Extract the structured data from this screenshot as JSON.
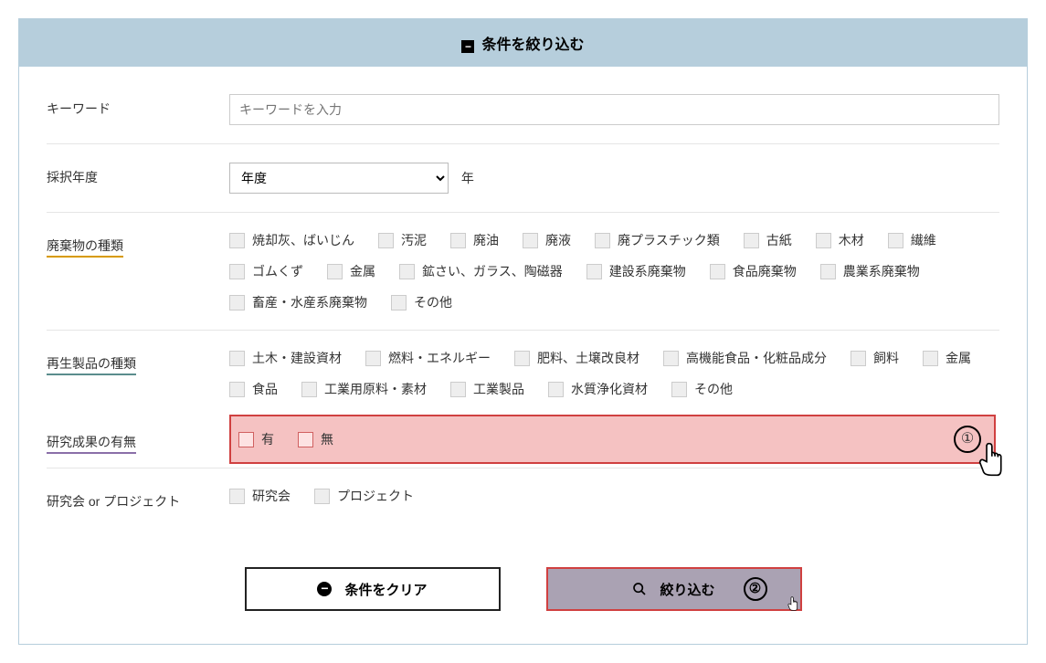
{
  "header": {
    "title": "条件を絞り込む"
  },
  "keyword": {
    "label": "キーワード",
    "placeholder": "キーワードを入力"
  },
  "year": {
    "label": "採択年度",
    "option": "年度",
    "suffix": "年"
  },
  "wasteType": {
    "label": "廃棄物の種類",
    "items": [
      "焼却灰、ばいじん",
      "汚泥",
      "廃油",
      "廃液",
      "廃プラスチック類",
      "古紙",
      "木材",
      "繊維",
      "ゴムくず",
      "金属",
      "鉱さい、ガラス、陶磁器",
      "建設系廃棄物",
      "食品廃棄物",
      "農業系廃棄物",
      "畜産・水産系廃棄物",
      "その他"
    ]
  },
  "recycledType": {
    "label": "再生製品の種類",
    "items": [
      "土木・建設資材",
      "燃料・エネルギー",
      "肥料、土壌改良材",
      "高機能食品・化粧品成分",
      "飼料",
      "金属",
      "食品",
      "工業用原料・素材",
      "工業製品",
      "水質浄化資材",
      "その他"
    ]
  },
  "results": {
    "label": "研究成果の有無",
    "yes": "有",
    "no": "無",
    "badge": "①"
  },
  "projectType": {
    "label": "研究会 or プロジェクト",
    "a": "研究会",
    "b": "プロジェクト"
  },
  "buttons": {
    "clear": "条件をクリア",
    "search": "絞り込む",
    "badge": "②"
  }
}
